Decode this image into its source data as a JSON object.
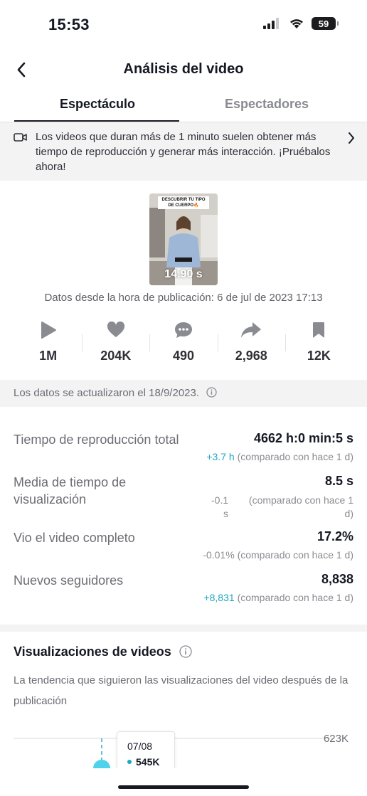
{
  "status_bar": {
    "time": "15:53",
    "battery": "59"
  },
  "nav": {
    "title": "Análisis del video"
  },
  "tabs": [
    {
      "label": "Espectáculo",
      "active": true
    },
    {
      "label": "Espectadores",
      "active": false
    }
  ],
  "banner": {
    "text": "Los videos que duran más de 1 minuto suelen obtener más tiempo de reproducción y generar más interacción. ¡Pruébalos ahora!",
    "icon": "video-camera-icon"
  },
  "thumbnail": {
    "caption": "DESCUBRIR TU TIPO DE CUERPO🔥",
    "duration": "14.90 s"
  },
  "published": "Datos desde la hora de publicación: 6 de jul de 2023 17:13",
  "metrics": [
    {
      "icon": "play-icon",
      "value": "1M"
    },
    {
      "icon": "heart-icon",
      "value": "204K"
    },
    {
      "icon": "comment-icon",
      "value": "490"
    },
    {
      "icon": "share-icon",
      "value": "2,968"
    },
    {
      "icon": "bookmark-icon",
      "value": "12K"
    }
  ],
  "updated": "Los datos se actualizaron el 18/9/2023.",
  "stats": [
    {
      "label": "Tiempo de reproducción total",
      "value": "4662 h:0 min:5 s",
      "delta": "+3.7 h",
      "compare": "(comparado con hace 1 d)"
    },
    {
      "label": "Media de tiempo de visualización",
      "value": "8.5 s",
      "delta": "-0.1 s",
      "compare": "(comparado con hace 1 d)"
    },
    {
      "label": "Vio el video completo",
      "value": "17.2%",
      "delta": "-0.01%",
      "compare": "(comparado con hace 1 d)"
    },
    {
      "label": "Nuevos seguidores",
      "value": "8,838",
      "delta": "+8,831",
      "compare": "(comparado con hace 1 d)"
    }
  ],
  "views_section": {
    "title": "Visualizaciones de videos",
    "description": "La tendencia que siguieron las visualizaciones del video después de la publicación",
    "y_max_label": "623K",
    "tooltip_date": "07/08",
    "tooltip_value": "545K"
  },
  "colors": {
    "accent": "#20a6c2",
    "text": "#161823",
    "muted": "#8a8b91",
    "band": "#f3f3f4"
  }
}
